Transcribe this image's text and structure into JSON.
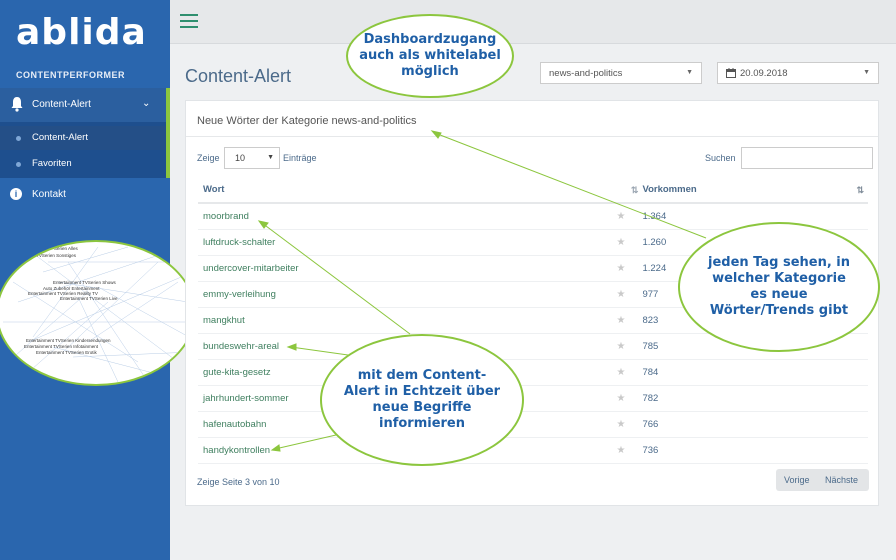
{
  "app": {
    "logo": "ablida",
    "tagline": "CONTENTPERFORMER"
  },
  "sidebar": {
    "active_item": "Content-Alert",
    "sub_items": [
      {
        "label": "Content-Alert"
      },
      {
        "label": "Favoriten"
      }
    ],
    "kontakt": "Kontakt"
  },
  "network_labels": [
    "Serien Alles",
    "Int TVSerien Sonstiges",
    "Entertainment TVSerien Shows",
    "Auto Zubehör Entertainment",
    "Entertainment TVSerien Reality TV",
    "Entertainment TVSerien Live",
    "Entertainment TVSerien Kindersendungen",
    "Entertainment TVSerien Infotainment",
    "Entertainment TVSerien Erotik"
  ],
  "header": {
    "page_title": "Content-Alert",
    "category_select": "news-and-politics",
    "date_select": "20.09.2018"
  },
  "panel": {
    "title": "Neue Wörter der Kategorie news-and-politics",
    "show_label": "Zeige",
    "show_value": "10",
    "entries_label": "Einträge",
    "search_label": "Suchen",
    "search_value": "",
    "columns": {
      "word": "Wort",
      "count": "Vorkommen"
    },
    "rows": [
      {
        "word": "moorbrand",
        "count": "1.364"
      },
      {
        "word": "luftdruck-schalter",
        "count": "1.260"
      },
      {
        "word": "undercover-mitarbeiter",
        "count": "1.224"
      },
      {
        "word": "emmy-verleihung",
        "count": "977"
      },
      {
        "word": "mangkhut",
        "count": "823"
      },
      {
        "word": "bundeswehr-areal",
        "count": "785"
      },
      {
        "word": "gute-kita-gesetz",
        "count": "784"
      },
      {
        "word": "jahrhundert-sommer",
        "count": "782"
      },
      {
        "word": "hafenautobahn",
        "count": "766"
      },
      {
        "word": "handykontrollen",
        "count": "736"
      }
    ],
    "page_info": "Zeige Seite 3 von 10",
    "prev": "Vorige",
    "next": "Nächste"
  },
  "callouts": {
    "whitelabel": [
      "Dashboardzugang",
      "auch als whitelabel",
      "möglich"
    ],
    "daily": [
      "jeden Tag sehen, in",
      "welcher Kategorie",
      "es neue",
      "Wörter/Trends gibt"
    ],
    "realtime": [
      "mit dem Content-",
      "Alert in Echtzeit über",
      "neue Begriffe",
      "informieren"
    ]
  },
  "colors": {
    "sidebar": "#2a66ae",
    "accent": "#8cc63e",
    "callout_text": "#1f5fa6"
  }
}
